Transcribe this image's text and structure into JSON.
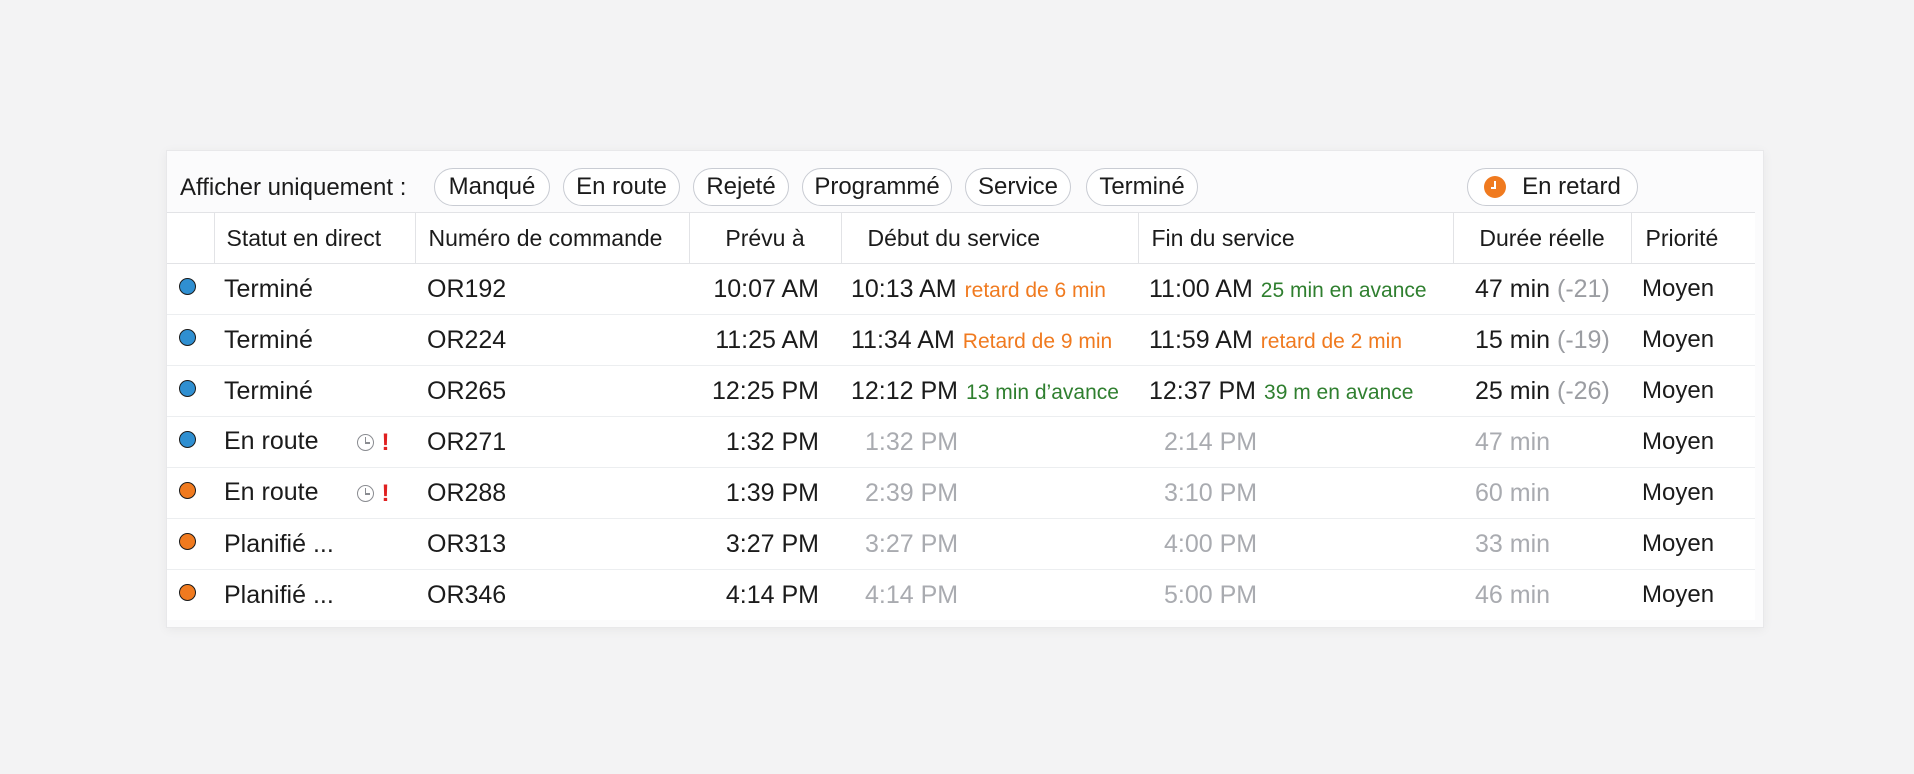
{
  "filters": {
    "label": "Afficher uniquement :",
    "chips": [
      "Manqué",
      "En route",
      "Rejeté",
      "Programmé",
      "Service",
      "Terminé"
    ],
    "late_chip": "En retard",
    "late_icon": "clock-alert-icon",
    "late_color": "#f07a1f"
  },
  "columns": [
    "",
    "Statut en direct",
    "Numéro de commande",
    "Prévu à",
    "Début du service",
    "Fin du service",
    "Durée réelle",
    "Priorité"
  ],
  "colors": {
    "blue": "#2f8fd1",
    "orange": "#f07a1f",
    "green": "#2f7f2f",
    "muted": "#a9abb0"
  },
  "rows": [
    {
      "dot": "#2f8fd1",
      "status": "Terminé",
      "icons": false,
      "order": "OR192",
      "planned": "10:07 AM",
      "start": "10:13 AM",
      "start_note": "retard de 6 min",
      "start_note_color": "#f07a1f",
      "end": "11:00 AM",
      "end_note": "25 min en avance",
      "end_note_color": "#2f7f2f",
      "duration": "47 min",
      "delta": "(-21)",
      "priority": "Moyen",
      "muted": false
    },
    {
      "dot": "#2f8fd1",
      "status": "Terminé",
      "icons": false,
      "order": "OR224",
      "planned": "11:25 AM",
      "start": "11:34 AM",
      "start_note": "Retard de 9 min",
      "start_note_color": "#f07a1f",
      "end": "11:59 AM",
      "end_note": "retard de 2 min",
      "end_note_color": "#f07a1f",
      "duration": "15 min",
      "delta": "(-19)",
      "priority": "Moyen",
      "muted": false
    },
    {
      "dot": "#2f8fd1",
      "status": "Terminé",
      "icons": false,
      "order": "OR265",
      "planned": "12:25 PM",
      "start": "12:12 PM",
      "start_note": "13 min d’avance",
      "start_note_color": "#2f7f2f",
      "end": "12:37 PM",
      "end_note": "39 m en avance",
      "end_note_color": "#2f7f2f",
      "duration": "25 min",
      "delta": "(-26)",
      "priority": "Moyen",
      "muted": false
    },
    {
      "dot": "#2f8fd1",
      "status": "En route",
      "icons": true,
      "order": "OR271",
      "planned": "1:32 PM",
      "start": "1:32 PM",
      "start_note": "",
      "start_note_color": "",
      "end": "2:14 PM",
      "end_note": "",
      "end_note_color": "",
      "duration": "47 min",
      "delta": "",
      "priority": "Moyen",
      "muted": true
    },
    {
      "dot": "#f07a1f",
      "status": "En route",
      "icons": true,
      "order": "OR288",
      "planned": "1:39 PM",
      "start": "2:39 PM",
      "start_note": "",
      "start_note_color": "",
      "end": "3:10 PM",
      "end_note": "",
      "end_note_color": "",
      "duration": "60 min",
      "delta": "",
      "priority": "Moyen",
      "muted": true
    },
    {
      "dot": "#f07a1f",
      "status": "Planifié ...",
      "icons": false,
      "order": "OR313",
      "planned": "3:27 PM",
      "start": "3:27 PM",
      "start_note": "",
      "start_note_color": "",
      "end": "4:00 PM",
      "end_note": "",
      "end_note_color": "",
      "duration": "33 min",
      "delta": "",
      "priority": "Moyen",
      "muted": true
    },
    {
      "dot": "#f07a1f",
      "status": "Planifié ...",
      "icons": false,
      "order": "OR346",
      "planned": "4:14 PM",
      "start": "4:14 PM",
      "start_note": "",
      "start_note_color": "",
      "end": "5:00 PM",
      "end_note": "",
      "end_note_color": "",
      "duration": "46 min",
      "delta": "",
      "priority": "Moyen",
      "muted": true
    }
  ]
}
